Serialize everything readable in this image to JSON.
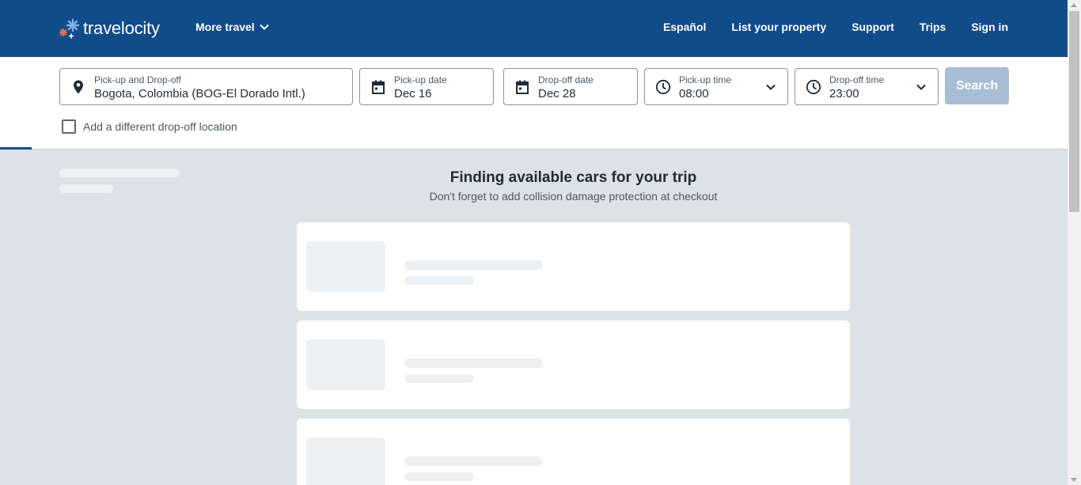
{
  "header": {
    "logo_text": "travelocity",
    "more_travel": "More travel",
    "nav": [
      "Español",
      "List your property",
      "Support",
      "Trips",
      "Sign in"
    ]
  },
  "search": {
    "location": {
      "label": "Pick-up and Drop-off",
      "value": "Bogota, Colombia (BOG-El Dorado Intl.)"
    },
    "pickup_date": {
      "label": "Pick-up date",
      "value": "Dec 16"
    },
    "dropoff_date": {
      "label": "Drop-off date",
      "value": "Dec 28"
    },
    "pickup_time": {
      "label": "Pick-up time",
      "value": "08:00"
    },
    "dropoff_time": {
      "label": "Drop-off time",
      "value": "23:00"
    },
    "search_button": "Search",
    "different_dropoff": "Add a different drop-off location"
  },
  "main": {
    "headline": "Finding available cars for your trip",
    "subline": "Don't forget to add collision damage protection at checkout"
  },
  "colors": {
    "header_bg": "#104b8a",
    "search_button_bg": "#a7bdd3",
    "page_bg": "#dde2e6",
    "logo_accent": "#e8704a",
    "logo_star": "#7fb2e5"
  },
  "icons": [
    "location-pin-icon",
    "calendar-icon",
    "clock-icon",
    "chevron-down-icon"
  ]
}
